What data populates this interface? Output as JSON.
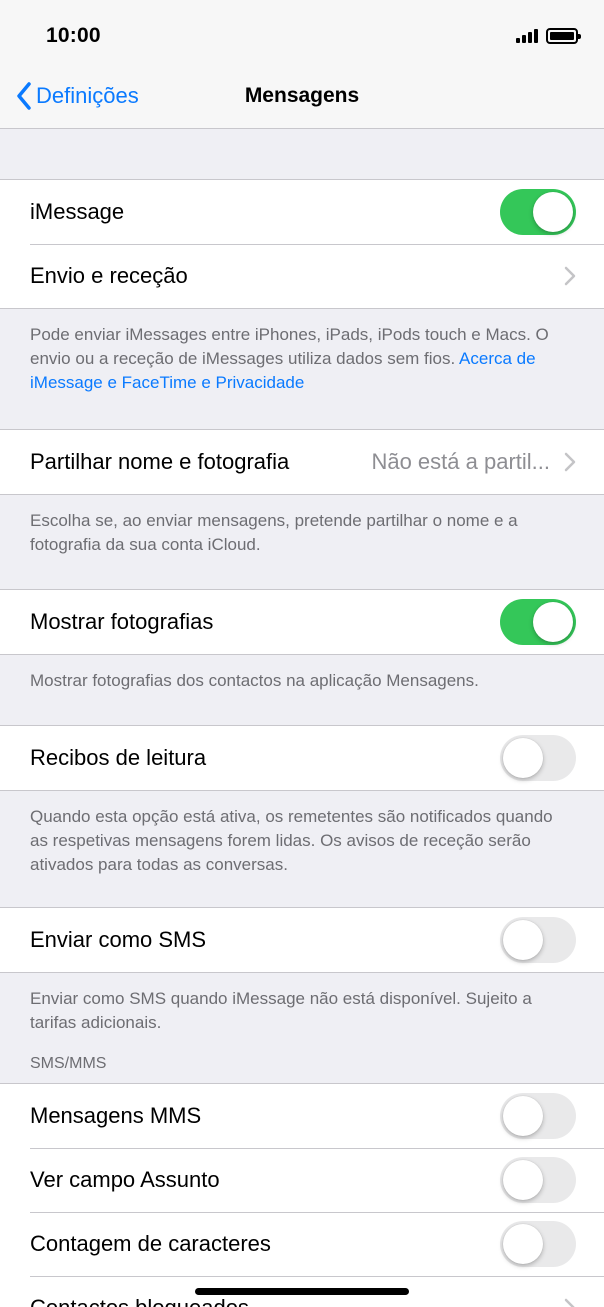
{
  "status": {
    "time": "10:00"
  },
  "nav": {
    "back_label": "Definições",
    "title": "Mensagens"
  },
  "rows": {
    "imessage": {
      "label": "iMessage",
      "on": true
    },
    "envio": {
      "label": "Envio e receção"
    },
    "partilhar": {
      "label": "Partilhar nome e fotografia",
      "value": "Não está a partil..."
    },
    "mostrar_fotos": {
      "label": "Mostrar fotografias",
      "on": true
    },
    "recibos": {
      "label": "Recibos de leitura",
      "on": false
    },
    "enviar_sms": {
      "label": "Enviar como SMS",
      "on": false
    },
    "mms": {
      "label": "Mensagens MMS",
      "on": false
    },
    "assunto": {
      "label": "Ver campo Assunto",
      "on": false
    },
    "contagem": {
      "label": "Contagem de caracteres",
      "on": false
    },
    "bloqueados": {
      "label": "Contactos bloqueados"
    }
  },
  "footers": {
    "imessage_text": "Pode enviar iMessages entre iPhones, iPads, iPods touch e Macs. O envio ou a receção de iMessages utiliza dados sem fios.",
    "imessage_link": "Acerca de iMessage e FaceTime e Privacidade",
    "partilhar": "Escolha se, ao enviar mensagens, pretende partilhar o nome e a fotografia da sua conta iCloud.",
    "mostrar_fotos": "Mostrar fotografias dos contactos na aplicação Mensagens.",
    "recibos": "Quando esta opção está ativa, os remetentes são notificados quando as respetivas mensagens forem lidas. Os avisos de receção serão ativados para todas as conversas.",
    "enviar_sms": "Enviar como SMS quando iMessage não está disponível. Sujeito a tarifas adicionais."
  },
  "sections": {
    "sms_mms": "SMS/MMS"
  },
  "colors": {
    "accent": "#0a7aff",
    "toggle_on": "#34c759",
    "toggle_off": "#e9e9ea"
  }
}
